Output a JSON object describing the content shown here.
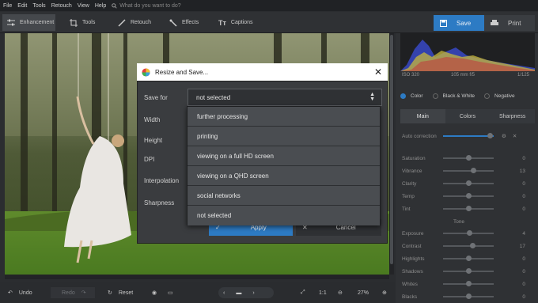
{
  "menu": {
    "items": [
      "File",
      "Edit",
      "Tools",
      "Retouch",
      "View",
      "Help"
    ],
    "search_placeholder": "What do you want to do?"
  },
  "toolbar": {
    "tabs": [
      "Enhancement",
      "Tools",
      "Retouch",
      "Effects",
      "Captions"
    ],
    "save": "Save",
    "print": "Print"
  },
  "photo_info": {
    "iso": "ISO 320",
    "lens": "105 mm f/5",
    "shutter": "1/125"
  },
  "color_mode": {
    "options": [
      "Color",
      "Black & White",
      "Negative"
    ],
    "selected": "Color"
  },
  "panel_tabs": [
    "Main",
    "Colors",
    "Sharpness"
  ],
  "auto_correction": "Auto correction",
  "adjustments": [
    {
      "label": "Saturation",
      "value": "0",
      "level": 0.5
    },
    {
      "label": "Vibrance",
      "value": "13",
      "level": 0.6
    },
    {
      "label": "Clarity",
      "value": "0",
      "level": 0.5
    },
    {
      "label": "Temp",
      "value": "0",
      "level": 0.5
    },
    {
      "label": "Tint",
      "value": "0",
      "level": 0.5
    }
  ],
  "tone_label": "Tone",
  "tone": [
    {
      "label": "Exposure",
      "value": "4",
      "level": 0.52
    },
    {
      "label": "Contrast",
      "value": "17",
      "level": 0.58
    },
    {
      "label": "Highlights",
      "value": "0",
      "level": 0.5
    },
    {
      "label": "Shadows",
      "value": "0",
      "level": 0.5
    },
    {
      "label": "Whites",
      "value": "0",
      "level": 0.5
    },
    {
      "label": "Blacks",
      "value": "0",
      "level": 0.5
    }
  ],
  "bottom": {
    "undo": "Undo",
    "redo": "Redo",
    "reset": "Reset",
    "ratio": "1:1",
    "zoom": "27%"
  },
  "dialog": {
    "title": "Resize and Save...",
    "fields": [
      "Save for",
      "Width",
      "Height",
      "DPI",
      "Interpolation",
      "Sharpness"
    ],
    "save_for_value": "not selected",
    "options": [
      "further processing",
      "printing",
      "viewing on a full HD screen",
      "viewing on a QHD screen",
      "social networks",
      "not selected"
    ],
    "apply": "Apply",
    "cancel": "Cancel"
  },
  "colors": {
    "accent": "#2d7bc4",
    "panel": "#2f3134",
    "background": "#2b2d30"
  }
}
